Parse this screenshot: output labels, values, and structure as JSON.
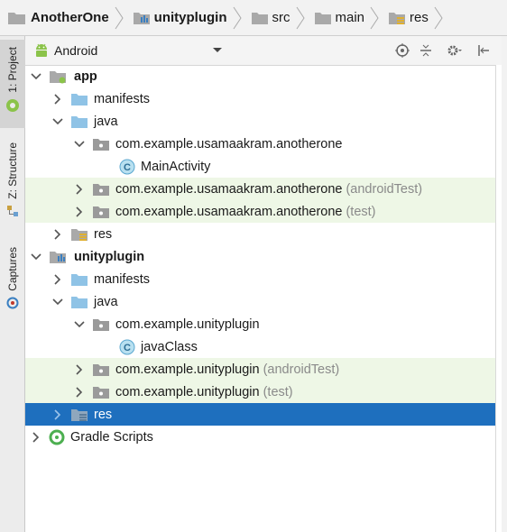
{
  "breadcrumb": {
    "items": [
      {
        "label": "AnotherOne",
        "icon": "project-folder-icon"
      },
      {
        "label": "unityplugin",
        "icon": "module-icon"
      },
      {
        "label": "src",
        "icon": "folder-icon"
      },
      {
        "label": "main",
        "icon": "folder-icon"
      },
      {
        "label": "res",
        "icon": "res-folder-icon"
      }
    ]
  },
  "sidebar": {
    "tabs": [
      {
        "label": "1: Project",
        "icon": "android-icon",
        "active": true
      },
      {
        "label": "Z: Structure",
        "icon": "structure-icon",
        "active": false
      },
      {
        "label": "Captures",
        "icon": "captures-icon",
        "active": false
      }
    ]
  },
  "toolbar": {
    "view_label": "Android",
    "buttons": [
      "target-icon",
      "collapse-all-icon",
      "gear-icon",
      "hide-panel-icon"
    ]
  },
  "tree": {
    "app": {
      "label": "app"
    },
    "app_manifests": {
      "label": "manifests"
    },
    "app_java": {
      "label": "java"
    },
    "app_pkg_main": {
      "label": "com.example.usamaakram.anotherone"
    },
    "app_main_activity": {
      "label": "MainActivity"
    },
    "app_pkg_android_test": {
      "label": "com.example.usamaakram.anotherone",
      "suffix": "(androidTest)"
    },
    "app_pkg_test": {
      "label": "com.example.usamaakram.anotherone",
      "suffix": "(test)"
    },
    "app_res": {
      "label": "res"
    },
    "unityplugin": {
      "label": "unityplugin"
    },
    "up_manifests": {
      "label": "manifests"
    },
    "up_java": {
      "label": "java"
    },
    "up_pkg_main": {
      "label": "com.example.unityplugin"
    },
    "up_java_class": {
      "label": "javaClass"
    },
    "up_pkg_android_test": {
      "label": "com.example.unityplugin",
      "suffix": "(androidTest)"
    },
    "up_pkg_test": {
      "label": "com.example.unityplugin",
      "suffix": "(test)"
    },
    "up_res": {
      "label": "res"
    },
    "gradle": {
      "label": "Gradle Scripts"
    }
  },
  "colors": {
    "selection": "#1e6fbe",
    "test_row_bg": "#eef7e6",
    "folder": "#8fc3e6",
    "package": "#9a9a9a",
    "android_green": "#8bc34a"
  }
}
